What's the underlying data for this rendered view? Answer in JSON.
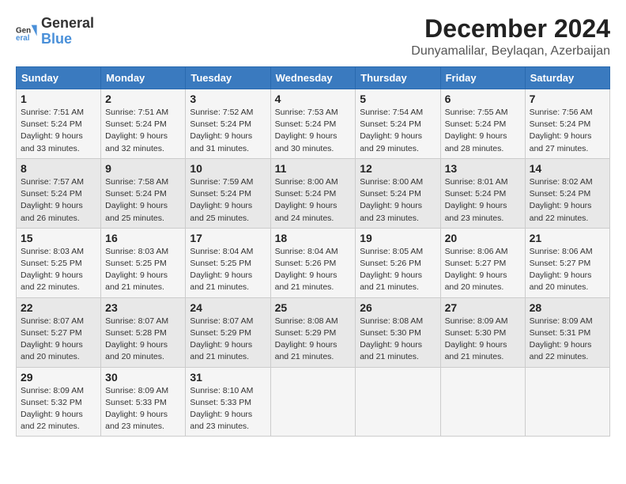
{
  "logo": {
    "text_general": "General",
    "text_blue": "Blue"
  },
  "title": "December 2024",
  "location": "Dunyamalilar, Beylaqan, Azerbaijan",
  "days_of_week": [
    "Sunday",
    "Monday",
    "Tuesday",
    "Wednesday",
    "Thursday",
    "Friday",
    "Saturday"
  ],
  "weeks": [
    [
      {
        "day": "1",
        "sunrise": "7:51 AM",
        "sunset": "5:24 PM",
        "daylight": "9 hours and 33 minutes."
      },
      {
        "day": "2",
        "sunrise": "7:51 AM",
        "sunset": "5:24 PM",
        "daylight": "9 hours and 32 minutes."
      },
      {
        "day": "3",
        "sunrise": "7:52 AM",
        "sunset": "5:24 PM",
        "daylight": "9 hours and 31 minutes."
      },
      {
        "day": "4",
        "sunrise": "7:53 AM",
        "sunset": "5:24 PM",
        "daylight": "9 hours and 30 minutes."
      },
      {
        "day": "5",
        "sunrise": "7:54 AM",
        "sunset": "5:24 PM",
        "daylight": "9 hours and 29 minutes."
      },
      {
        "day": "6",
        "sunrise": "7:55 AM",
        "sunset": "5:24 PM",
        "daylight": "9 hours and 28 minutes."
      },
      {
        "day": "7",
        "sunrise": "7:56 AM",
        "sunset": "5:24 PM",
        "daylight": "9 hours and 27 minutes."
      }
    ],
    [
      {
        "day": "8",
        "sunrise": "7:57 AM",
        "sunset": "5:24 PM",
        "daylight": "9 hours and 26 minutes."
      },
      {
        "day": "9",
        "sunrise": "7:58 AM",
        "sunset": "5:24 PM",
        "daylight": "9 hours and 25 minutes."
      },
      {
        "day": "10",
        "sunrise": "7:59 AM",
        "sunset": "5:24 PM",
        "daylight": "9 hours and 25 minutes."
      },
      {
        "day": "11",
        "sunrise": "8:00 AM",
        "sunset": "5:24 PM",
        "daylight": "9 hours and 24 minutes."
      },
      {
        "day": "12",
        "sunrise": "8:00 AM",
        "sunset": "5:24 PM",
        "daylight": "9 hours and 23 minutes."
      },
      {
        "day": "13",
        "sunrise": "8:01 AM",
        "sunset": "5:24 PM",
        "daylight": "9 hours and 23 minutes."
      },
      {
        "day": "14",
        "sunrise": "8:02 AM",
        "sunset": "5:24 PM",
        "daylight": "9 hours and 22 minutes."
      }
    ],
    [
      {
        "day": "15",
        "sunrise": "8:03 AM",
        "sunset": "5:25 PM",
        "daylight": "9 hours and 22 minutes."
      },
      {
        "day": "16",
        "sunrise": "8:03 AM",
        "sunset": "5:25 PM",
        "daylight": "9 hours and 21 minutes."
      },
      {
        "day": "17",
        "sunrise": "8:04 AM",
        "sunset": "5:25 PM",
        "daylight": "9 hours and 21 minutes."
      },
      {
        "day": "18",
        "sunrise": "8:04 AM",
        "sunset": "5:26 PM",
        "daylight": "9 hours and 21 minutes."
      },
      {
        "day": "19",
        "sunrise": "8:05 AM",
        "sunset": "5:26 PM",
        "daylight": "9 hours and 21 minutes."
      },
      {
        "day": "20",
        "sunrise": "8:06 AM",
        "sunset": "5:27 PM",
        "daylight": "9 hours and 20 minutes."
      },
      {
        "day": "21",
        "sunrise": "8:06 AM",
        "sunset": "5:27 PM",
        "daylight": "9 hours and 20 minutes."
      }
    ],
    [
      {
        "day": "22",
        "sunrise": "8:07 AM",
        "sunset": "5:27 PM",
        "daylight": "9 hours and 20 minutes."
      },
      {
        "day": "23",
        "sunrise": "8:07 AM",
        "sunset": "5:28 PM",
        "daylight": "9 hours and 20 minutes."
      },
      {
        "day": "24",
        "sunrise": "8:07 AM",
        "sunset": "5:29 PM",
        "daylight": "9 hours and 21 minutes."
      },
      {
        "day": "25",
        "sunrise": "8:08 AM",
        "sunset": "5:29 PM",
        "daylight": "9 hours and 21 minutes."
      },
      {
        "day": "26",
        "sunrise": "8:08 AM",
        "sunset": "5:30 PM",
        "daylight": "9 hours and 21 minutes."
      },
      {
        "day": "27",
        "sunrise": "8:09 AM",
        "sunset": "5:30 PM",
        "daylight": "9 hours and 21 minutes."
      },
      {
        "day": "28",
        "sunrise": "8:09 AM",
        "sunset": "5:31 PM",
        "daylight": "9 hours and 22 minutes."
      }
    ],
    [
      {
        "day": "29",
        "sunrise": "8:09 AM",
        "sunset": "5:32 PM",
        "daylight": "9 hours and 22 minutes."
      },
      {
        "day": "30",
        "sunrise": "8:09 AM",
        "sunset": "5:33 PM",
        "daylight": "9 hours and 23 minutes."
      },
      {
        "day": "31",
        "sunrise": "8:10 AM",
        "sunset": "5:33 PM",
        "daylight": "9 hours and 23 minutes."
      },
      null,
      null,
      null,
      null
    ]
  ]
}
